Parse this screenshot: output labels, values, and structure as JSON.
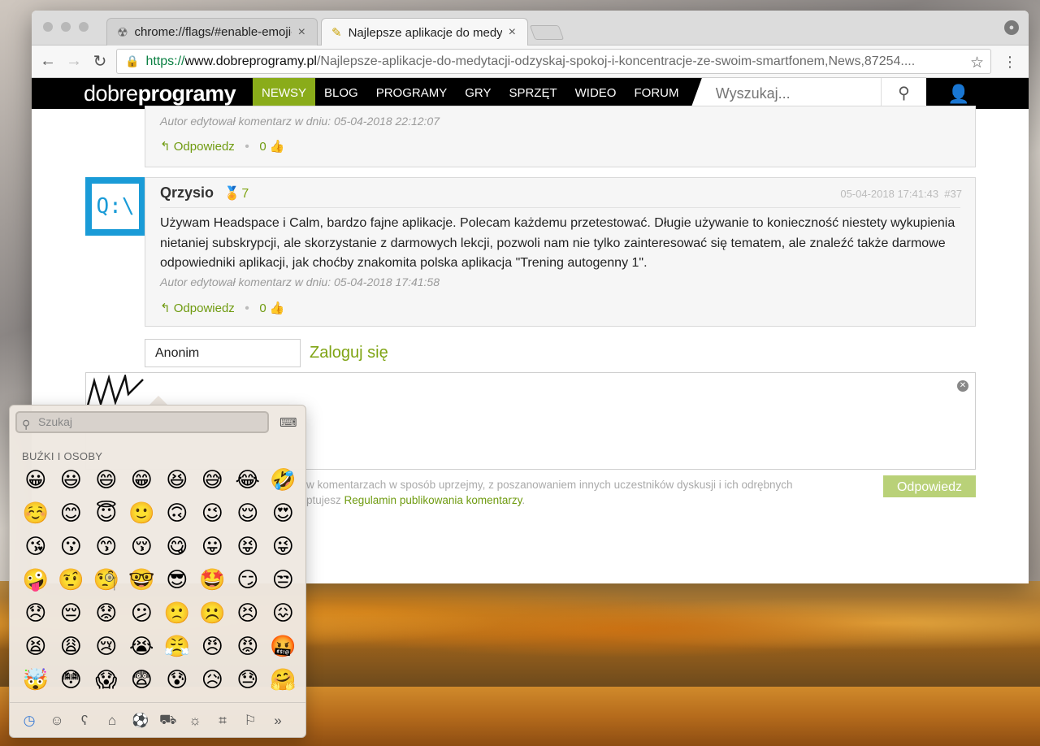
{
  "browser": {
    "tabs": [
      {
        "title": "chrome://flags/#enable-emoji-",
        "close": "×",
        "icon": "radiation-icon"
      },
      {
        "title": "Najlepsze aplikacje do medytac",
        "close": "×",
        "icon": "site-favicon"
      }
    ],
    "url": {
      "scheme": "https://",
      "host": "www.dobreprogramy.pl",
      "path": "/Najlepsze-aplikacje-do-medytacji-odzyskaj-spokoj-i-koncentracje-ze-swoim-smartfonem,News,87254...."
    }
  },
  "site": {
    "logo_light": "dobre",
    "logo_bold": "programy",
    "nav": [
      "NEWSY",
      "BLOG",
      "PROGRAMY",
      "GRY",
      "SPRZĘT",
      "WIDEO",
      "FORUM"
    ],
    "search_placeholder": "Wyszukaj..."
  },
  "comments": [
    {
      "edited": "Autor edytował komentarz w dniu: 05-04-2018 22:12:07",
      "reply": "Odpowiedz",
      "votes": "0"
    },
    {
      "author": "Qrzysio",
      "badge": "7",
      "avatar_text": "Q:\\",
      "date": "05-04-2018 17:41:43",
      "number": "#37",
      "body": "Używam Headspace i Calm, bardzo fajne aplikacje. Polecam każdemu przetestować. Długie używanie to konieczność niestety wykupienia nietaniej subskrypcji, ale skorzystanie z darmowych lekcji, pozwoli nam nie tylko zainteresować się tematem, ale znaleźć także darmowe odpowiedniki aplikacji, jak choćby znakomita polska aplikacja \"Trening autogenny 1\".",
      "edited": "Autor edytował komentarz w dniu: 05-04-2018 17:41:58",
      "reply": "Odpowiedz",
      "votes": "0"
    }
  ],
  "reply_form": {
    "name_value": "Anonim",
    "login_link": "Zaloguj się",
    "rules_line1": "w komentarzach w sposób uprzejmy, z poszanowaniem innych uczestników dyskusji i ich odrębnych",
    "rules_line2_prefix": "ptujesz ",
    "rules_link": "Regulamin publikowania komentarzy",
    "rules_line2_suffix": ".",
    "submit": "Odpowiedz"
  },
  "emoji_picker": {
    "search_placeholder": "Szukaj",
    "category": "BUŹKI I OSOBY",
    "emojis": [
      "😀",
      "😃",
      "😄",
      "😁",
      "😆",
      "😅",
      "😂",
      "🤣",
      "☺️",
      "😊",
      "😇",
      "🙂",
      "🙃",
      "😉",
      "😌",
      "😍",
      "😘",
      "😗",
      "😙",
      "😚",
      "😋",
      "😛",
      "😝",
      "😜",
      "🤪",
      "🤨",
      "🧐",
      "🤓",
      "😎",
      "🤩",
      "😏",
      "😒",
      "😞",
      "😔",
      "😟",
      "😕",
      "🙁",
      "☹️",
      "😣",
      "😖",
      "😫",
      "😩",
      "😢",
      "😭",
      "😤",
      "😠",
      "😡",
      "🤬",
      "🤯",
      "😳",
      "😱",
      "😨",
      "😰",
      "😥",
      "😓",
      "🤗"
    ],
    "category_tabs": [
      "clock-icon",
      "smiley-icon",
      "bear-icon",
      "cake-icon",
      "ball-icon",
      "car-icon",
      "bulb-icon",
      "symbols-icon",
      "flag-icon",
      "more-icon"
    ]
  },
  "colors": {
    "accent_green": "#8aac1a",
    "link_green": "#6f9b10",
    "header_black": "#000000",
    "submit_disabled": "#b9d178"
  }
}
